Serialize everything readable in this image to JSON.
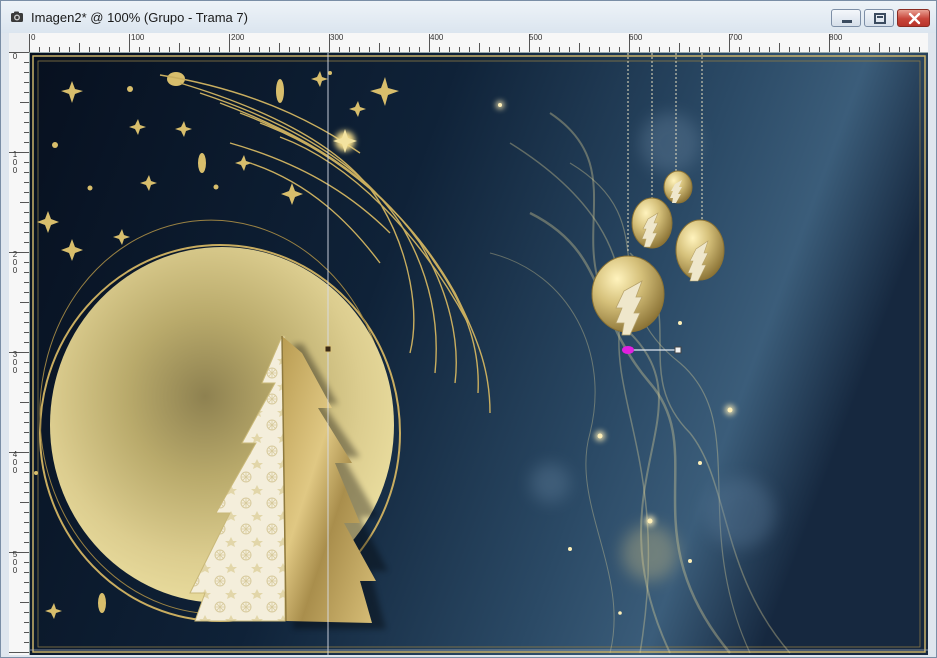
{
  "window": {
    "title": "Imagen2* @ 100% (Grupo - Trama 7)",
    "controls": [
      "minimize",
      "maximize",
      "close"
    ]
  },
  "ruler": {
    "top_labels": [
      "0",
      "100",
      "200",
      "300",
      "400",
      "500",
      "600",
      "700",
      "800"
    ],
    "left_labels": [
      "0",
      "100",
      "200",
      "300",
      "400",
      "500"
    ]
  },
  "canvas": {
    "theme_colors": {
      "background_dark": "#0b1628",
      "background_blue": "#2c4a66",
      "gold": "#d9c27a",
      "gold_dark": "#a88e45",
      "paper": "#f4eedb",
      "node_magenta": "#e020e0"
    },
    "icons": [
      "camera-icon",
      "minimize-icon",
      "maximize-icon",
      "close-icon"
    ]
  }
}
